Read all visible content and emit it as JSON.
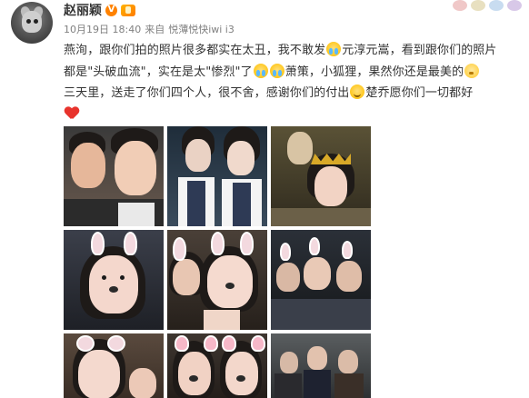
{
  "post": {
    "username": "赵丽颖",
    "vip_mark": "V",
    "date": "10月19日 18:40",
    "source_prefix": "来自",
    "source": "悦薄悦快iwi i3",
    "text": {
      "line1_a": "燕洵，跟你们拍的照片很多都实在太丑，我不敢发",
      "line1_b": "元淳元嵩，看到跟你们的照片",
      "line2_a": "都是\"头破血流\"，实在是太\"惨烈\"了",
      "line2_b": "萧策，小狐狸，果然你还是最美的",
      "line3_a": "三天里，送走了你们四个人，很不舍，感谢你们的付出",
      "line3_b": "楚乔愿你们一切都好"
    },
    "icons": {
      "vip": "vip-badge-icon",
      "level": "level-medal-icon",
      "cry_emoji": "crying-laugh-emoji",
      "smile_emoji": "smile-emoji",
      "think_emoji": "thinking-emoji",
      "heart": "heart-icon"
    }
  },
  "photos": [
    {
      "id": "photo-1",
      "theme": "two-faces-closeup"
    },
    {
      "id": "photo-2",
      "theme": "two-girls-uniform"
    },
    {
      "id": "photo-3",
      "theme": "crown-and-elf"
    },
    {
      "id": "photo-4",
      "theme": "bunny-filter"
    },
    {
      "id": "photo-5",
      "theme": "bunny-filter-pair"
    },
    {
      "id": "photo-6",
      "theme": "bunny-group"
    },
    {
      "id": "photo-7",
      "theme": "mouse-filter"
    },
    {
      "id": "photo-8",
      "theme": "dog-filter"
    },
    {
      "id": "photo-9",
      "theme": "costume-group"
    }
  ],
  "colors": {
    "text": "#333333",
    "meta": "#808080",
    "vip": "#ff8200",
    "heart": "#e8332c"
  }
}
